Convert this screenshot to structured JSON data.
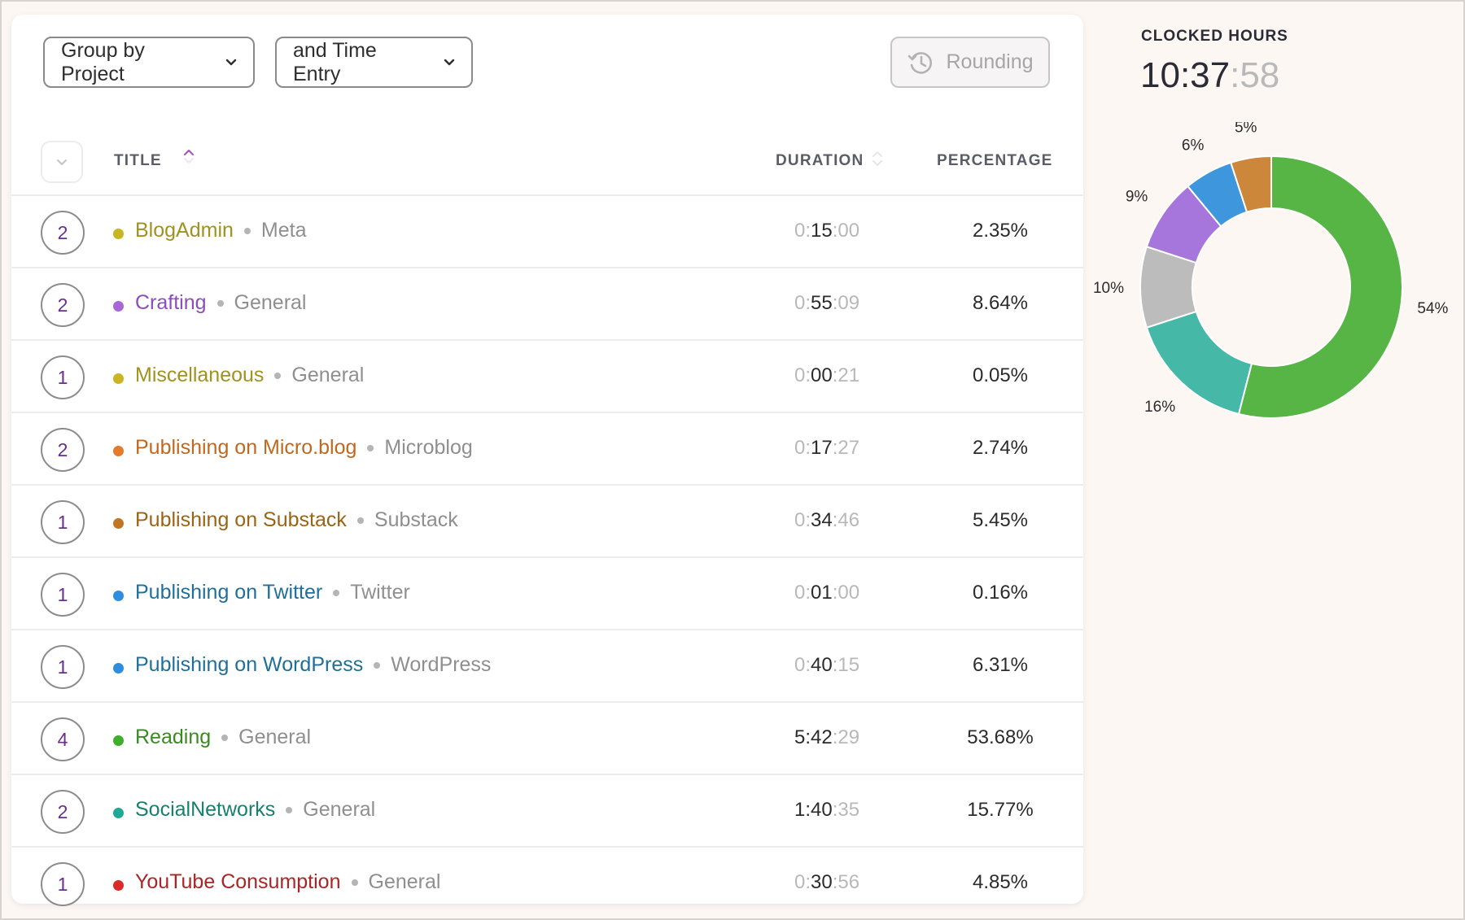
{
  "toolbar": {
    "group_by": "Group by Project",
    "then_by": "and Time Entry",
    "rounding": "Rounding"
  },
  "table": {
    "headers": {
      "title": "TITLE",
      "duration": "DURATION",
      "percentage": "PERCENTAGE"
    },
    "rows": [
      {
        "count": "2",
        "project": "BlogAdmin",
        "client": "Meta",
        "dur_h": "0:",
        "dur_m": "15",
        "dur_s": ":00",
        "h_strong": false,
        "percentage": "2.35%",
        "color": "#c9b422",
        "text_color": "#a0921e"
      },
      {
        "count": "2",
        "project": "Crafting",
        "client": "General",
        "dur_h": "0:",
        "dur_m": "55",
        "dur_s": ":09",
        "h_strong": false,
        "percentage": "8.64%",
        "color": "#a866d6",
        "text_color": "#8b4dbf"
      },
      {
        "count": "1",
        "project": "Miscellaneous",
        "client": "General",
        "dur_h": "0:",
        "dur_m": "00",
        "dur_s": ":21",
        "h_strong": false,
        "percentage": "0.05%",
        "color": "#c9b422",
        "text_color": "#a0921e"
      },
      {
        "count": "2",
        "project": "Publishing on Micro.blog",
        "client": "Microblog",
        "dur_h": "0:",
        "dur_m": "17",
        "dur_s": ":27",
        "h_strong": false,
        "percentage": "2.74%",
        "color": "#e37a2c",
        "text_color": "#c0691e"
      },
      {
        "count": "1",
        "project": "Publishing on Substack",
        "client": "Substack",
        "dur_h": "0:",
        "dur_m": "34",
        "dur_s": ":46",
        "h_strong": false,
        "percentage": "5.45%",
        "color": "#bf7524",
        "text_color": "#9b6415"
      },
      {
        "count": "1",
        "project": "Publishing on Twitter",
        "client": "Twitter",
        "dur_h": "0:",
        "dur_m": "01",
        "dur_s": ":00",
        "h_strong": false,
        "percentage": "0.16%",
        "color": "#2f8de0",
        "text_color": "#1f6f9a"
      },
      {
        "count": "1",
        "project": "Publishing on WordPress",
        "client": "WordPress",
        "dur_h": "0:",
        "dur_m": "40",
        "dur_s": ":15",
        "h_strong": false,
        "percentage": "6.31%",
        "color": "#2f8de0",
        "text_color": "#1f6f9a"
      },
      {
        "count": "4",
        "project": "Reading",
        "client": "General",
        "dur_h": "5:",
        "dur_m": "42",
        "dur_s": ":29",
        "h_strong": true,
        "percentage": "53.68%",
        "color": "#3fae2c",
        "text_color": "#3a8a22"
      },
      {
        "count": "2",
        "project": "SocialNetworks",
        "client": "General",
        "dur_h": "1:",
        "dur_m": "40",
        "dur_s": ":35",
        "h_strong": true,
        "percentage": "15.77%",
        "color": "#1fa896",
        "text_color": "#17806f"
      },
      {
        "count": "1",
        "project": "YouTube Consumption",
        "client": "General",
        "dur_h": "0:",
        "dur_m": "30",
        "dur_s": ":56",
        "h_strong": false,
        "percentage": "4.85%",
        "color": "#d92b2b",
        "text_color": "#a92626"
      }
    ]
  },
  "summary": {
    "label": "CLOCKED HOURS",
    "hours_minutes": "10:37",
    "seconds": ":58"
  },
  "chart_data": {
    "type": "pie",
    "donut": true,
    "slices": [
      {
        "label": "54%",
        "value": 54,
        "color": "#56b544"
      },
      {
        "label": "16%",
        "value": 16,
        "color": "#45b8a8"
      },
      {
        "label": "10%",
        "value": 10,
        "color": "#bcbcbc"
      },
      {
        "label": "9%",
        "value": 9,
        "color": "#a676dd"
      },
      {
        "label": "6%",
        "value": 6,
        "color": "#3e96dd"
      },
      {
        "label": "5%",
        "value": 5,
        "color": "#cd873b"
      }
    ]
  }
}
